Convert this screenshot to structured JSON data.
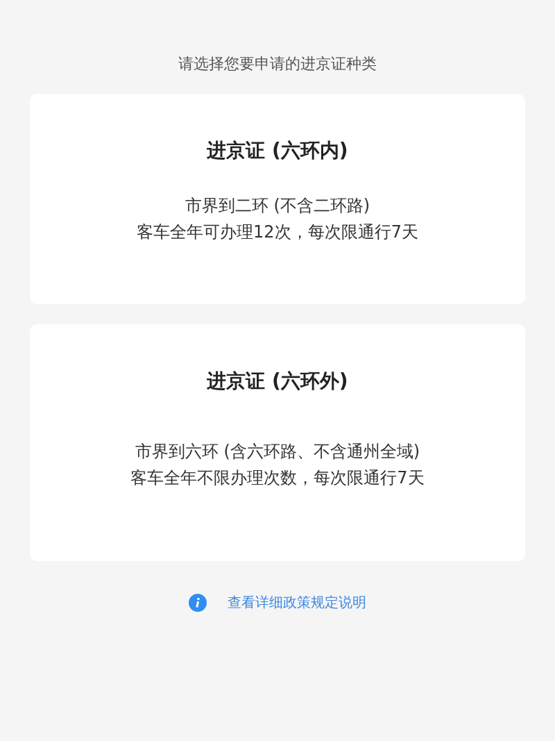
{
  "heading": "请选择您要申请的进京证种类",
  "options": [
    {
      "title": "进京证 (六环内)",
      "lines": [
        "市界到二环 (不含二环路)",
        "客车全年可办理12次，每次限通行7天"
      ]
    },
    {
      "title": "进京证 (六环外)",
      "lines": [
        "市界到六环 (含六环路、不含通州全域)",
        "客车全年不限办理次数，每次限通行7天"
      ]
    }
  ],
  "info_link": {
    "label": "查看详细政策规定说明"
  }
}
